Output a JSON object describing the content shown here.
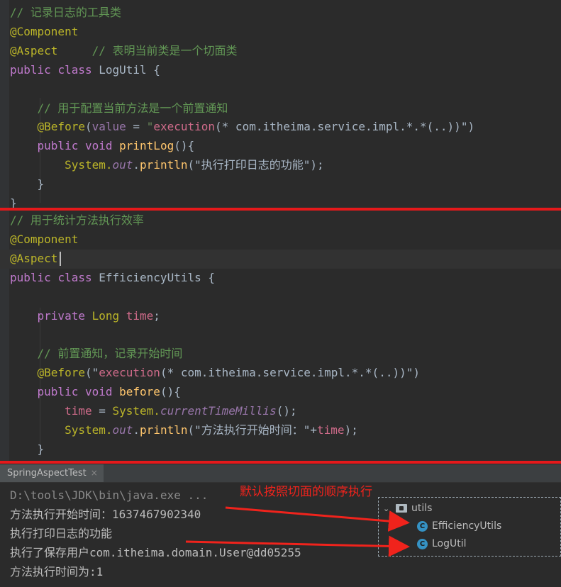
{
  "editor1": {
    "lines": [
      [
        {
          "t": "// 记录日志的工具类",
          "c": "c-comment"
        }
      ],
      [
        {
          "t": "@Component",
          "c": "c-ann"
        }
      ],
      [
        {
          "t": "@Aspect",
          "c": "c-ann"
        },
        {
          "t": "     // 表明当前类是一个切面类",
          "c": "c-comment"
        }
      ],
      [
        {
          "t": "public ",
          "c": "c-kw2"
        },
        {
          "t": "class ",
          "c": "c-kw2"
        },
        {
          "t": "LogUtil {",
          "c": "c-plain"
        }
      ],
      [],
      [
        {
          "t": "    // 用于配置当前方法是一个前置通知",
          "c": "c-comment"
        }
      ],
      [
        {
          "t": "    @Before",
          "c": "c-ann"
        },
        {
          "t": "(",
          "c": "c-plain"
        },
        {
          "t": "value",
          "c": "c-field"
        },
        {
          "t": " = ",
          "c": "c-plain"
        },
        {
          "t": "\"",
          "c": "c-str"
        },
        {
          "t": "execution",
          "c": "c-pink"
        },
        {
          "t": "(* com.itheima.service.impl.*.*(..))\"",
          "c": "c-plain"
        },
        {
          "t": ")",
          "c": "c-plain"
        }
      ],
      [
        {
          "t": "    public ",
          "c": "c-kw2"
        },
        {
          "t": "void ",
          "c": "c-kw2"
        },
        {
          "t": "printLog",
          "c": "c-method"
        },
        {
          "t": "(){",
          "c": "c-plain"
        }
      ],
      [
        {
          "t": "        System.",
          "c": "c-ann2"
        },
        {
          "t": "out",
          "c": "c-static"
        },
        {
          "t": ".",
          "c": "c-plain"
        },
        {
          "t": "println",
          "c": "c-method"
        },
        {
          "t": "(\"执行打印日志的功能\");",
          "c": "c-plain"
        }
      ],
      [
        {
          "t": "    }",
          "c": "c-plain"
        }
      ],
      [
        {
          "t": "}",
          "c": "c-plain"
        }
      ]
    ]
  },
  "editor2": {
    "lines": [
      [
        {
          "t": "// 用于统计方法执行效率",
          "c": "c-comment"
        }
      ],
      [
        {
          "t": "@Component",
          "c": "c-ann"
        }
      ],
      [
        {
          "t": "@Aspect",
          "c": "c-ann"
        }
      ],
      [
        {
          "t": "public ",
          "c": "c-kw2"
        },
        {
          "t": "class ",
          "c": "c-kw2"
        },
        {
          "t": "EfficiencyUtils {",
          "c": "c-plain"
        }
      ],
      [],
      [
        {
          "t": "    private ",
          "c": "c-kw2"
        },
        {
          "t": "Long ",
          "c": "c-ann2"
        },
        {
          "t": "time",
          "c": "c-pink"
        },
        {
          "t": ";",
          "c": "c-plain"
        }
      ],
      [],
      [
        {
          "t": "    // 前置通知，记录开始时间",
          "c": "c-comment"
        }
      ],
      [
        {
          "t": "    @Before",
          "c": "c-ann"
        },
        {
          "t": "(\"",
          "c": "c-plain"
        },
        {
          "t": "execution",
          "c": "c-pink"
        },
        {
          "t": "(* com.itheima.service.impl.*.*(..))\")",
          "c": "c-plain"
        }
      ],
      [
        {
          "t": "    public ",
          "c": "c-kw2"
        },
        {
          "t": "void ",
          "c": "c-kw2"
        },
        {
          "t": "before",
          "c": "c-method"
        },
        {
          "t": "(){",
          "c": "c-plain"
        }
      ],
      [
        {
          "t": "        time",
          "c": "c-pink"
        },
        {
          "t": " = ",
          "c": "c-plain"
        },
        {
          "t": "System.",
          "c": "c-ann2"
        },
        {
          "t": "currentTimeMillis",
          "c": "c-static"
        },
        {
          "t": "();",
          "c": "c-plain"
        }
      ],
      [
        {
          "t": "        System.",
          "c": "c-ann2"
        },
        {
          "t": "out",
          "c": "c-static"
        },
        {
          "t": ".",
          "c": "c-plain"
        },
        {
          "t": "println",
          "c": "c-method"
        },
        {
          "t": "(\"方法执行开始时间：\"+",
          "c": "c-plain"
        },
        {
          "t": "time",
          "c": "c-pink"
        },
        {
          "t": ");",
          "c": "c-plain"
        }
      ],
      [
        {
          "t": "    }",
          "c": "c-plain"
        }
      ]
    ]
  },
  "run": {
    "tab_label": "SpringAspectTest",
    "tab_close": "×",
    "output": [
      "D:\\tools\\JDK\\bin\\java.exe ...",
      "方法执行开始时间：1637467902340",
      "执行打印日志的功能",
      "执行了保存用户com.itheima.domain.User@dd05255",
      "方法执行时间为:1"
    ],
    "note": "默认按照切面的顺序执行"
  },
  "tree": {
    "folder": "utils",
    "items": [
      {
        "label": "EfficiencyUtils",
        "icon": "C"
      },
      {
        "label": "LogUtil",
        "icon": "C"
      }
    ]
  },
  "colors": {
    "separator": "#e5191b",
    "arrow": "#f0231c"
  }
}
